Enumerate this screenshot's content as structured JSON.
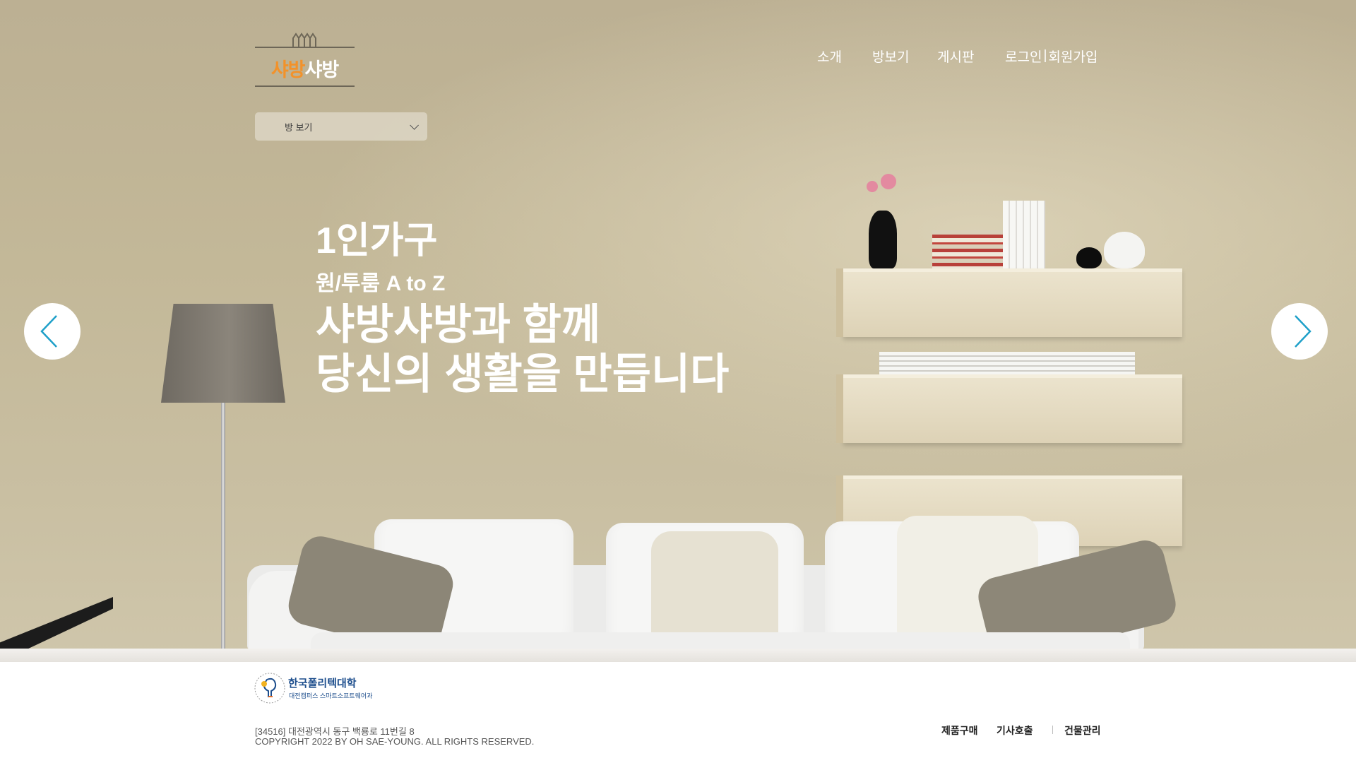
{
  "header": {
    "logo": {
      "text_a": "샤방",
      "text_b": "샤방"
    },
    "nav": [
      {
        "label": "소개"
      },
      {
        "label": "방보기"
      },
      {
        "label": "게시판"
      }
    ],
    "auth": {
      "login": "로그인",
      "separator": "|",
      "signup": "회원가입"
    }
  },
  "room_select": {
    "selected": "방 보기"
  },
  "hero": {
    "line1": "1인가구",
    "line2": "원/투룸 A to Z",
    "line3": "샤방샤방과 함께",
    "line4": "당신의 생활을 만듭니다"
  },
  "footer": {
    "school_name": "한국폴리텍대학",
    "school_sub": "대전캠퍼스 스마트소프트웨어과",
    "address": "[34516] 대전광역시 동구 백룡로 11번길 8",
    "copyright": "COPYRIGHT 2022 BY OH SAE-YOUNG. ALL RIGHTS RESERVED.",
    "links": [
      "제품구매",
      "기사호출",
      "건물관리"
    ]
  },
  "icons": {
    "prev": "chevron-left-icon",
    "next": "chevron-right-icon",
    "dropdown": "chevron-down-icon"
  },
  "colors": {
    "logo_accent": "#f2922b",
    "arrow": "#1fa0c9",
    "school_blue": "#1c4d8c"
  }
}
